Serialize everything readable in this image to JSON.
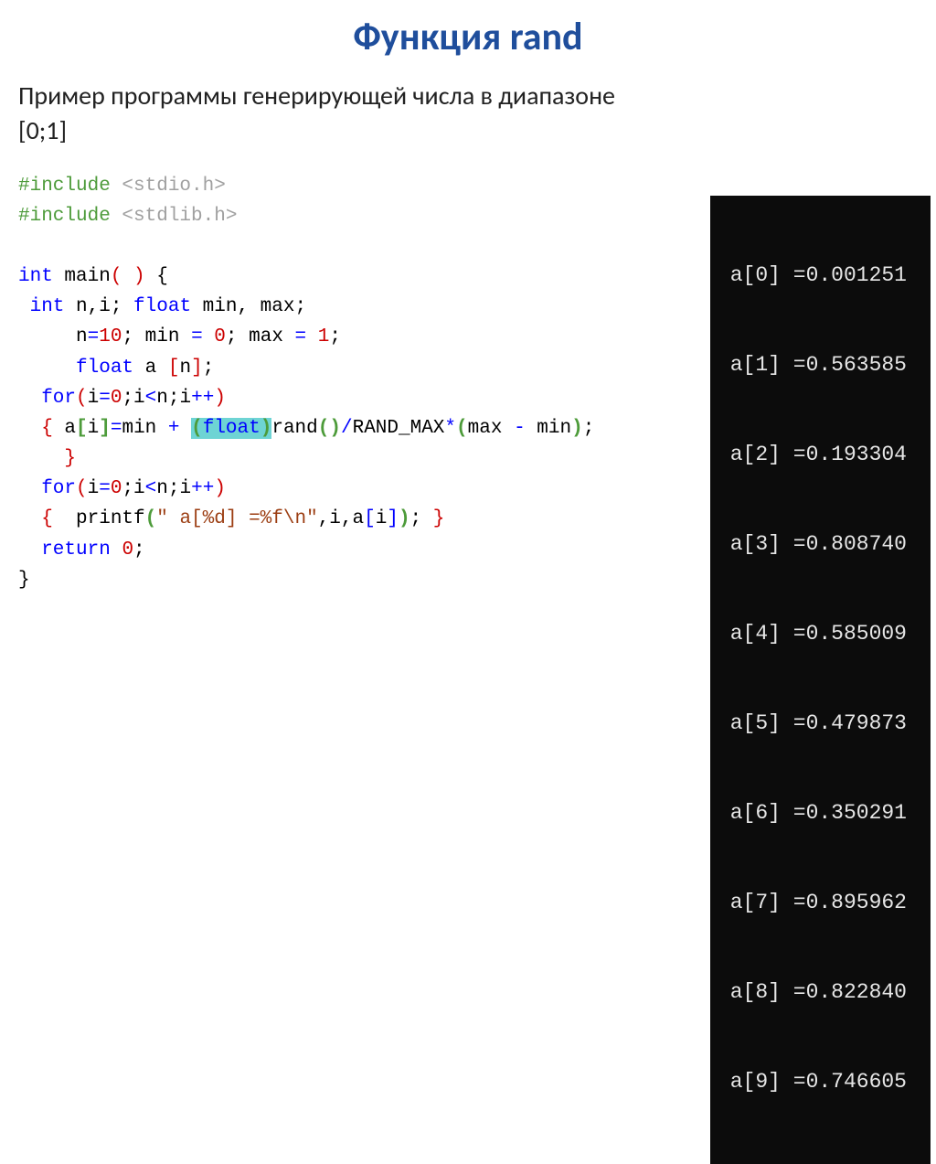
{
  "title": "Функция rand",
  "subtitle_line1": "Пример программы генерирующей числа в диапазоне",
  "subtitle_line2": "[0;1]",
  "code": {
    "l1_pre": "#include ",
    "l1_path": "<stdio.h>",
    "l2_pre": "#include ",
    "l2_path": "<stdlib.h>",
    "l3": "",
    "l4_int": "int",
    "l4_main": " main",
    "l4_p1": "( )",
    "l4_brace": " {",
    "l5_int": " int",
    "l5_vars": " n,i; ",
    "l5_float": "float",
    "l5_vars2": " min, max;",
    "l6_n": "     n",
    "l6_eq1": "=",
    "l6_v1": "10",
    "l6_sc1": "; min ",
    "l6_eq2": "= ",
    "l6_v2": "0",
    "l6_sc2": "; max ",
    "l6_eq3": "= ",
    "l6_v3": "1",
    "l6_sc3": ";",
    "l7_float": "     float",
    "l7_arr": " a ",
    "l7_b1": "[",
    "l7_n": "n",
    "l7_b2": "]",
    "l7_sc": ";",
    "l8_for": "  for",
    "l8_p1": "(",
    "l8_i": "i",
    "l8_eq": "=",
    "l8_z": "0",
    "l8_sc1": ";i",
    "l8_lt": "<",
    "l8_n": "n;i",
    "l8_pp": "++",
    "l8_p2": ")",
    "l9_b1": "  {",
    "l9_sp": " a",
    "l9_br1": "[",
    "l9_i": "i",
    "l9_br2": "]",
    "l9_eq": "=",
    "l9_min": "min ",
    "l9_plus": "+ ",
    "l9_cast_o": "(",
    "l9_float": "float",
    "l9_cast_c": ")",
    "l9_rand": "rand",
    "l9_rp1": "(",
    "l9_rp2": ")",
    "l9_div": "/",
    "l9_rmax": "RAND_MAX",
    "l9_mul": "*",
    "l9_mp1": "(",
    "l9_max": "max ",
    "l9_minus": "- ",
    "l9_min2": "min",
    "l9_mp2": ")",
    "l9_sc": ";",
    "l10_b": "    }",
    "l11_for": "  for",
    "l11_p1": "(",
    "l11_i": "i",
    "l11_eq": "=",
    "l11_z": "0",
    "l11_sc1": ";i",
    "l11_lt": "<",
    "l11_n": "n;i",
    "l11_pp": "++",
    "l11_p2": ")",
    "l12_b1": "  {",
    "l12_pr": "  printf",
    "l12_p1": "(",
    "l12_str": "\" a[%d] =%f\\n\"",
    "l12_c1": ",i,a",
    "l12_br1": "[",
    "l12_i": "i",
    "l12_br2": "]",
    "l12_p2": ")",
    "l12_sc": "; ",
    "l12_b2": "}",
    "l13_ret": "  return",
    "l13_sp": " ",
    "l13_z": "0",
    "l13_sc": ";",
    "l14_b": "}"
  },
  "output": [
    " a[0] =0.001251",
    " a[1] =0.563585",
    " a[2] =0.193304",
    " a[3] =0.808740",
    " a[4] =0.585009",
    " a[5] =0.479873",
    " a[6] =0.350291",
    " a[7] =0.895962",
    " a[8] =0.822840",
    " a[9] =0.746605"
  ]
}
